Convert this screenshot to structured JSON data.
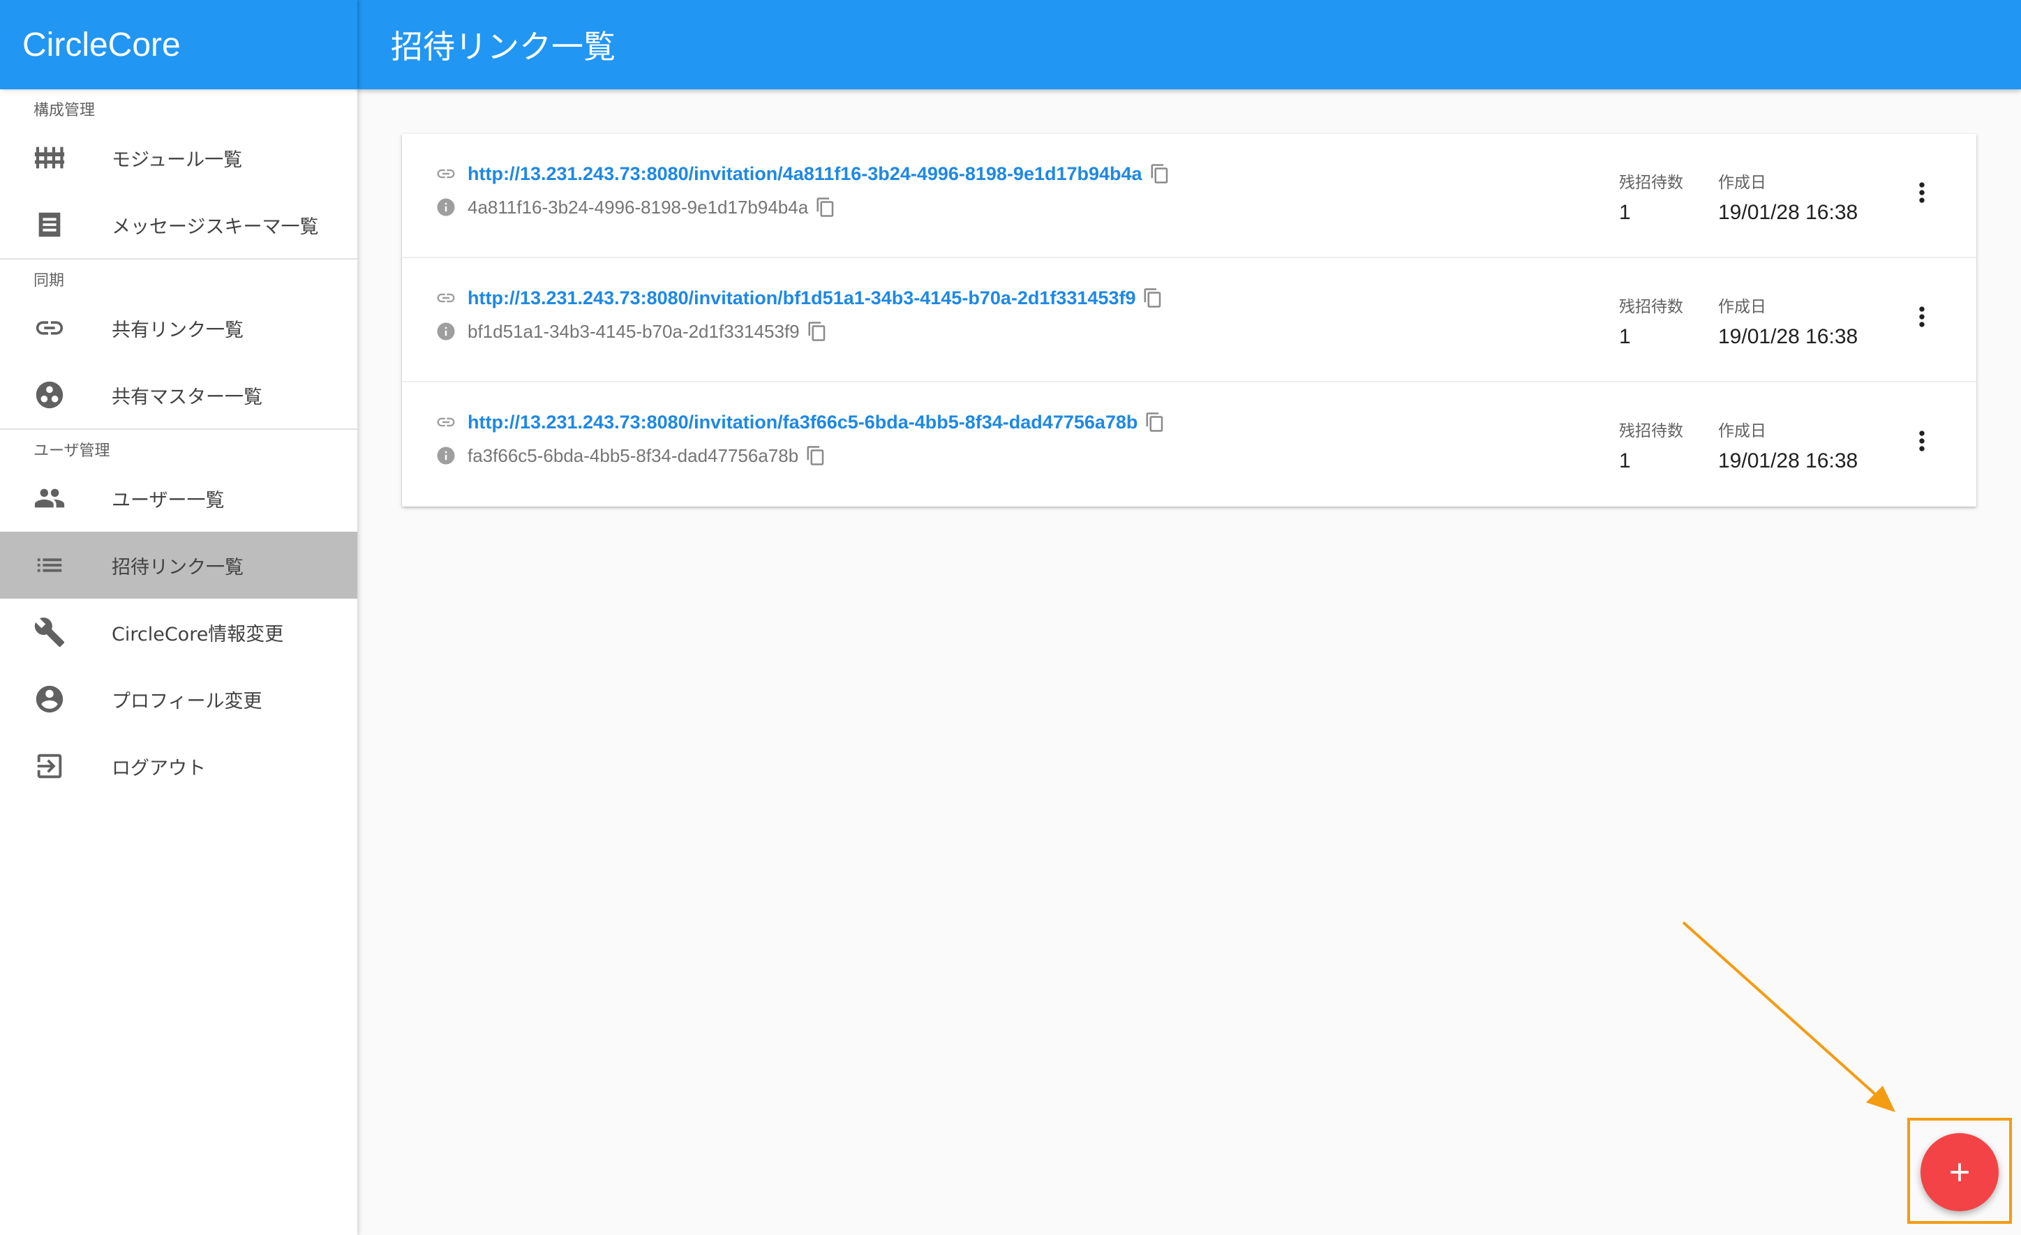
{
  "app": {
    "title": "CircleCore"
  },
  "header": {
    "title": "招待リンク一覧"
  },
  "sidebar": {
    "sections": [
      {
        "header": "構成管理",
        "items": [
          {
            "label": "モジュール一覧",
            "icon": "module-icon"
          },
          {
            "label": "メッセージスキーマ一覧",
            "icon": "schema-icon"
          }
        ]
      },
      {
        "header": "同期",
        "items": [
          {
            "label": "共有リンク一覧",
            "icon": "link-icon"
          },
          {
            "label": "共有マスター一覧",
            "icon": "master-icon"
          }
        ]
      },
      {
        "header": "ユーザ管理",
        "items": [
          {
            "label": "ユーザー一覧",
            "icon": "people-icon"
          },
          {
            "label": "招待リンク一覧",
            "icon": "list-icon",
            "active": true
          },
          {
            "label": "CircleCore情報変更",
            "icon": "wrench-icon"
          },
          {
            "label": "プロフィール変更",
            "icon": "account-icon"
          },
          {
            "label": "ログアウト",
            "icon": "logout-icon"
          }
        ]
      }
    ]
  },
  "invitations": {
    "remaining_label": "残招待数",
    "created_label": "作成日",
    "rows": [
      {
        "url": "http://13.231.243.73:8080/invitation/4a811f16-3b24-4996-8198-9e1d17b94b4a",
        "token": "4a811f16-3b24-4996-8198-9e1d17b94b4a",
        "remaining": "1",
        "created": "19/01/28 16:38"
      },
      {
        "url": "http://13.231.243.73:8080/invitation/bf1d51a1-34b3-4145-b70a-2d1f331453f9",
        "token": "bf1d51a1-34b3-4145-b70a-2d1f331453f9",
        "remaining": "1",
        "created": "19/01/28 16:38"
      },
      {
        "url": "http://13.231.243.73:8080/invitation/fa3f66c5-6bda-4bb5-8f34-dad47756a78b",
        "token": "fa3f66c5-6bda-4bb5-8f34-dad47756a78b",
        "remaining": "1",
        "created": "19/01/28 16:38"
      }
    ]
  },
  "colors": {
    "primary": "#2196f3",
    "fab": "#f44346",
    "annotation": "#f39c12",
    "active_item": "#bdbdbd"
  }
}
